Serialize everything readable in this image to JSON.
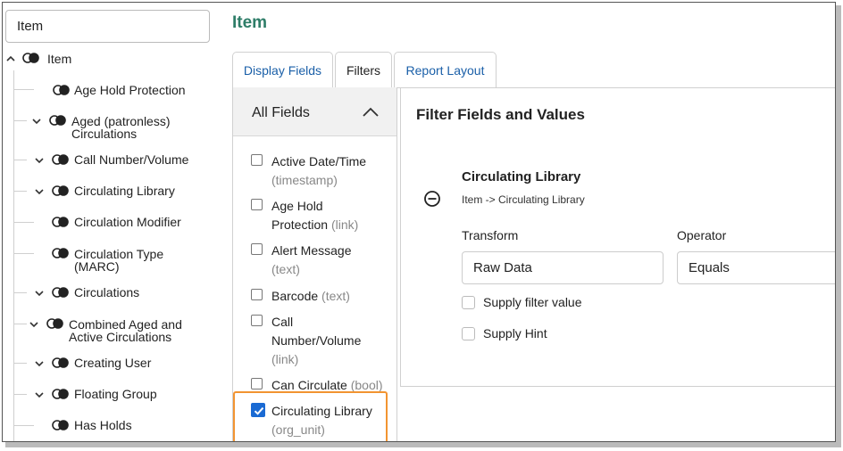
{
  "sidebar": {
    "search_value": "Item",
    "root": {
      "label": "Item",
      "expanded": true
    },
    "items": [
      {
        "label": "Age Hold Protection",
        "expandable": false
      },
      {
        "label": "Aged (patronless) Circulations",
        "line1": "Aged (patronless)",
        "line2": "Circulations",
        "expandable": true
      },
      {
        "label": "Call Number/Volume",
        "expandable": true
      },
      {
        "label": "Circulating Library",
        "expandable": true
      },
      {
        "label": "Circulation Modifier",
        "expandable": false
      },
      {
        "label": "Circulation Type (MARC)",
        "line1": "Circulation Type",
        "line2": "(MARC)",
        "expandable": false
      },
      {
        "label": "Circulations",
        "expandable": true
      },
      {
        "label": "Combined Aged and Active Circulations",
        "line1": "Combined Aged and",
        "line2": "Active Circulations",
        "expandable": true
      },
      {
        "label": "Creating User",
        "expandable": true
      },
      {
        "label": "Floating Group",
        "expandable": true
      },
      {
        "label": "Has Holds",
        "expandable": false
      }
    ]
  },
  "main": {
    "title": "Item",
    "tabs": [
      {
        "label": "Display Fields",
        "active": false
      },
      {
        "label": "Filters",
        "active": true
      },
      {
        "label": "Report Layout",
        "active": false
      }
    ]
  },
  "fields_panel": {
    "heading": "All Fields",
    "fields": [
      {
        "label_l1": "Active Date/Time",
        "type": "(timestamp)",
        "checked": false
      },
      {
        "label_l1": "Age Hold",
        "label_l2": "Protection",
        "type": "(link)",
        "checked": false
      },
      {
        "label_l1": "Alert Message",
        "type": "(text)",
        "checked": false
      },
      {
        "label_l1": "Barcode",
        "type": "(text)",
        "checked": false
      },
      {
        "label_l1": "Call",
        "label_l2": "Number/Volume",
        "type": "(link)",
        "checked": false
      },
      {
        "label_l1": "Can Circulate",
        "type": "(bool)",
        "checked": false
      },
      {
        "label_l1": "Circulating Library",
        "type": "(org_unit)",
        "checked": true
      }
    ]
  },
  "filter_panel": {
    "heading": "Filter Fields and Values",
    "filter": {
      "name": "Circulating Library",
      "path": "Item -> Circulating Library",
      "transform_label": "Transform",
      "transform_value": "Raw Data",
      "operator_label": "Operator",
      "operator_value": "Equals",
      "supply_filter_value_label": "Supply filter value",
      "supply_hint_label": "Supply Hint"
    }
  },
  "colors": {
    "accent_title": "#2e7d68",
    "tab_link": "#1a5fa8",
    "checkbox_checked": "#1a6ad3",
    "highlight": "#f29431"
  }
}
